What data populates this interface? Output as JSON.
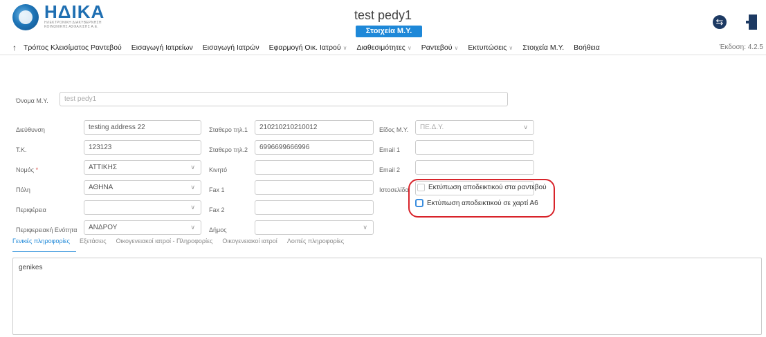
{
  "header": {
    "logo_text": "ΗΔΙΚΑ",
    "logo_sub1": "ΗΛΕΚΤΡΟΝΙΚΗ ΔΙΑΚΥΒΕΡΝΗΣΗ",
    "logo_sub2": "ΚΟΙΝΩΝΙΚΗΣ ΑΣΦΑΛΙΣΗΣ Α.Ε.",
    "title": "test pedy1",
    "badge": "Στοιχεία Μ.Υ."
  },
  "nav": {
    "items": [
      {
        "label": "Τρόπος Κλεισίματος Ραντεβού",
        "caret": false
      },
      {
        "label": "Εισαγωγή Ιατρείων",
        "caret": false
      },
      {
        "label": "Εισαγωγή Ιατρών",
        "caret": false
      },
      {
        "label": "Εφαρμογή Οικ. Ιατρού",
        "caret": true
      },
      {
        "label": "Διαθεσιμότητες",
        "caret": true
      },
      {
        "label": "Ραντεβού",
        "caret": true
      },
      {
        "label": "Εκτυπώσεις",
        "caret": true
      },
      {
        "label": "Στοιχεία Μ.Υ.",
        "caret": false
      },
      {
        "label": "Βοήθεια",
        "caret": false
      }
    ],
    "version": "Έκδοση: 4.2.5"
  },
  "form": {
    "name_label": "Όνομα Μ.Υ.",
    "name_value": "test pedy1",
    "address_label": "Διεύθυνση",
    "address_value": "testing address 22",
    "zip_label": "Τ.Κ.",
    "zip_value": "123123",
    "prefecture_label": "Νομός",
    "prefecture_required": "*",
    "prefecture_value": "ΑΤΤΙΚΗΣ",
    "city_label": "Πόλη",
    "city_value": "ΑΘΗΝΑ",
    "region_label": "Περιφέρεια",
    "region_value": "",
    "regional_unit_label": "Περιφερειακή Ενότητα",
    "regional_unit_value": "ΑΝΔΡΟΥ",
    "phone1_label": "Σταθερο τηλ.1",
    "phone1_value": "210210210210012",
    "phone2_label": "Σταθερο τηλ.2",
    "phone2_value": "6996699666996",
    "mobile_label": "Κινητό",
    "mobile_value": "",
    "fax1_label": "Fax 1",
    "fax1_value": "",
    "fax2_label": "Fax 2",
    "fax2_value": "",
    "municipality_label": "Δήμος",
    "municipality_value": "",
    "unit_type_label": "Είδος Μ.Υ.",
    "unit_type_value": "ΠΕ.Δ.Υ.",
    "email1_label": "Email 1",
    "email1_value": "",
    "email2_label": "Email 2",
    "email2_value": "",
    "website_label": "Ιστοσελίδα",
    "website_value": "",
    "print_receipt_label": "Εκτύπωση αποδεικτικού στα ραντεβού",
    "print_a6_label": "Εκτύπωση αποδεικτικού σε χαρτί Α6",
    "print_receipt_checked": false,
    "print_a6_checked": false
  },
  "tabs": [
    {
      "label": "Γενικές πληροφορίες",
      "active": true
    },
    {
      "label": "Εξετάσεις",
      "active": false
    },
    {
      "label": "Οικογενειακοί ιατροί - Πληροφορίες",
      "active": false
    },
    {
      "label": "Οικογενειακοί ιατροί",
      "active": false
    },
    {
      "label": "Λοιπές πληροφορίες",
      "active": false
    }
  ],
  "notes_value": "genikes",
  "colors": {
    "brand_blue": "#1e88d8",
    "highlight_red": "#d8232a",
    "dark_navy": "#1d3a63"
  },
  "icons": {
    "back": "arrow-up-icon",
    "logout": "logout-icon",
    "exit": "exit-door-icon",
    "select": "chevron-down-icon"
  }
}
